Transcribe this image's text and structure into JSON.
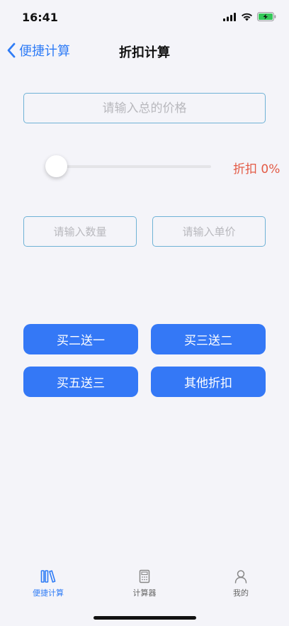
{
  "status_bar": {
    "time": "16:41"
  },
  "nav": {
    "back_label": "便捷计算",
    "title": "折扣计算"
  },
  "form": {
    "total_price_placeholder": "请输入总的价格",
    "quantity_placeholder": "请输入数量",
    "unit_price_placeholder": "请输入单价"
  },
  "slider": {
    "value_percent": 0,
    "discount_label": "折扣 0%"
  },
  "presets": [
    {
      "label": "买二送一"
    },
    {
      "label": "买三送二"
    },
    {
      "label": "买五送三"
    },
    {
      "label": "其他折扣"
    }
  ],
  "tabs": [
    {
      "label": "便捷计算",
      "icon": "books-icon",
      "active": true
    },
    {
      "label": "计算器",
      "icon": "calculator-icon",
      "active": false
    },
    {
      "label": "我的",
      "icon": "person-icon",
      "active": false
    }
  ],
  "colors": {
    "accent": "#2f7cf6",
    "button": "#3478f6",
    "discount_text": "#e35a45",
    "input_border": "#6fb2d6",
    "background": "#f4f4f9"
  }
}
